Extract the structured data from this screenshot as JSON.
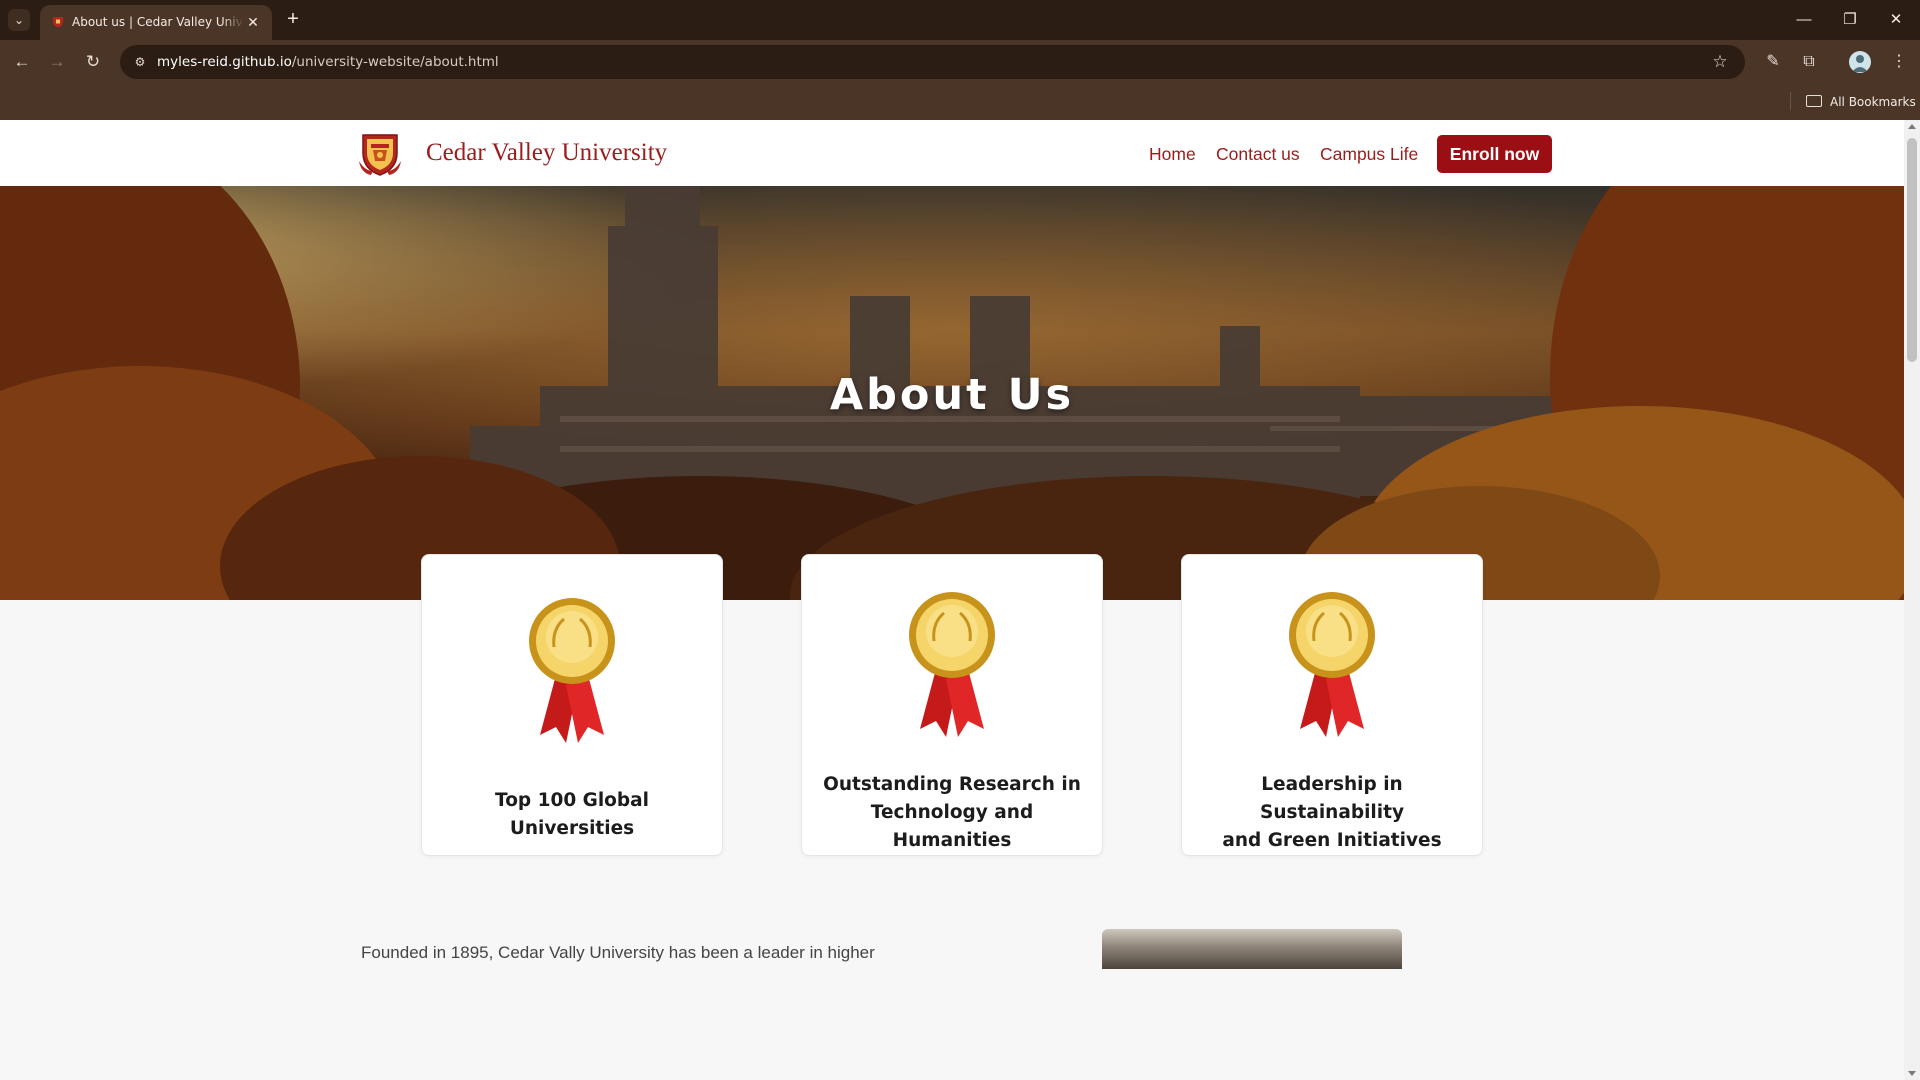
{
  "browser": {
    "tab_title": "About us | Cedar Valley University",
    "new_tab_symbol": "+",
    "close_symbol": "✕",
    "url_host": "myles-reid.github.io",
    "url_path": "/university-website/about.html",
    "bookmarks_label": "All Bookmarks",
    "icons": [
      "tab-search-icon",
      "back-icon",
      "forward-icon",
      "reload-icon",
      "site-info-icon",
      "bookmark-star-icon",
      "extension-pin-icon",
      "extensions-icon",
      "profile-avatar",
      "menu-icon",
      "minimize-icon",
      "restore-icon",
      "close-window-icon",
      "folder-icon"
    ]
  },
  "site": {
    "brand": "Cedar Valley University",
    "nav": {
      "home": "Home",
      "contact": "Contact us",
      "campus": "Campus Life",
      "enroll": "Enroll now"
    },
    "colors": {
      "brand": "#9b1c1c",
      "enroll_bg": "#9a0e14"
    }
  },
  "hero": {
    "title": "About Us"
  },
  "awards": [
    {
      "line1": "Top 100 Global Universities",
      "line2": ""
    },
    {
      "line1": "Outstanding Research in",
      "line2": "Technology and Humanities"
    },
    {
      "line1": "Leadership in Sustainability",
      "line2": "and Green Initiatives"
    }
  ],
  "about": {
    "founded_text": "Founded in 1895, Cedar Vally University has been a leader in higher"
  }
}
